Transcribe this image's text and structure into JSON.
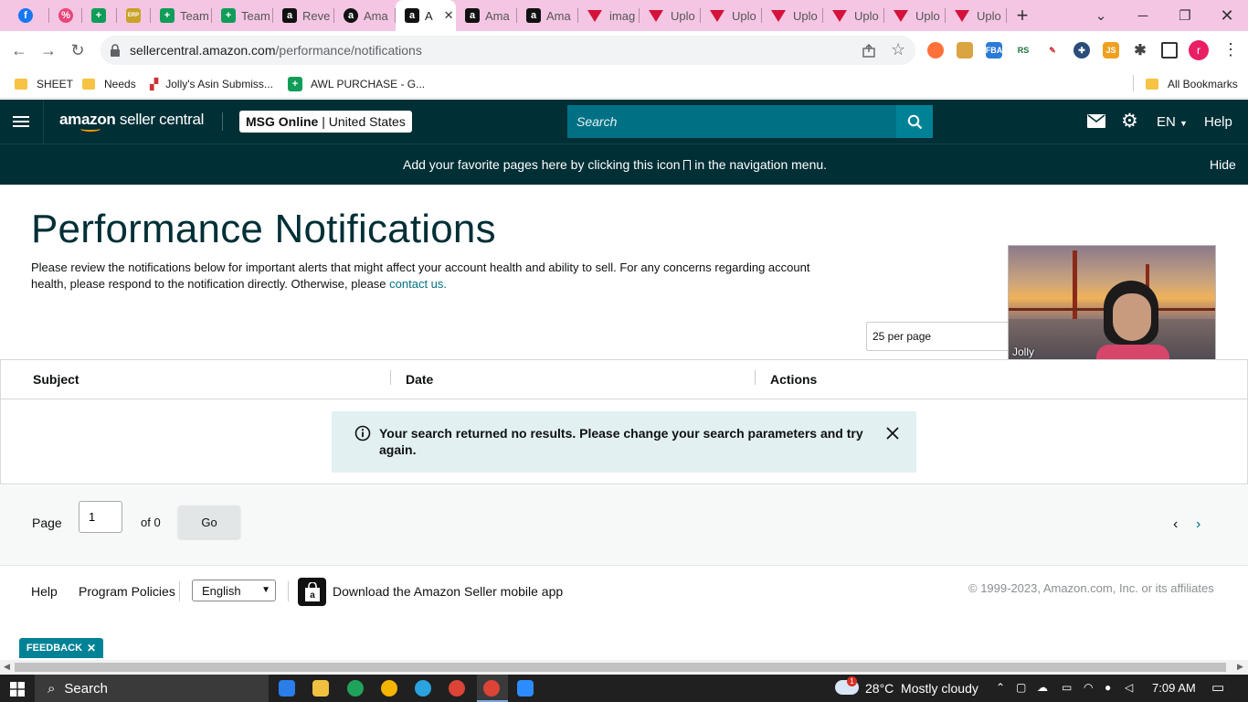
{
  "browser": {
    "tabs": [
      {
        "label": "",
        "icon": "facebook-icon"
      },
      {
        "label": "",
        "icon": "percent-icon"
      },
      {
        "label": "",
        "icon": "sheets-icon"
      },
      {
        "label": "",
        "icon": "erp-icon"
      },
      {
        "label": "Team",
        "icon": "sheets-icon"
      },
      {
        "label": "Team",
        "icon": "sheets-icon"
      },
      {
        "label": "Reve",
        "icon": "amazon-icon"
      },
      {
        "label": "Ama",
        "icon": "amazon-circle-icon"
      },
      {
        "label": "A",
        "icon": "amazon-icon",
        "active": true
      },
      {
        "label": "Ama",
        "icon": "amazon-icon"
      },
      {
        "label": "Ama",
        "icon": "amazon-icon"
      },
      {
        "label": "imag",
        "icon": "triangle-icon"
      },
      {
        "label": "Uplo",
        "icon": "triangle-icon"
      },
      {
        "label": "Uplo",
        "icon": "triangle-icon"
      },
      {
        "label": "Uplo",
        "icon": "triangle-icon"
      },
      {
        "label": "Uplo",
        "icon": "triangle-icon"
      },
      {
        "label": "Uplo",
        "icon": "triangle-icon"
      },
      {
        "label": "Uplo",
        "icon": "triangle-icon"
      }
    ],
    "url_domain": "sellercentral.amazon.com",
    "url_path": "/performance/notifications",
    "profile_initial": "r",
    "bookmarks": {
      "sheet": "SHEET",
      "needs": "Needs",
      "asin": "Jolly's Asin Submiss...",
      "awl": "AWL PURCHASE - G...",
      "all": "All Bookmarks"
    }
  },
  "header": {
    "logo_bold": "amazon",
    "logo_light": " seller central",
    "store_name": "MSG Online",
    "store_sep": " | ",
    "store_region": "United States",
    "search_placeholder": "Search",
    "lang": "EN",
    "help": "Help"
  },
  "banner": {
    "text_before": "Add your favorite pages here by clicking this icon",
    "text_after": "in the navigation menu.",
    "hide": "Hide"
  },
  "page": {
    "title": "Performance Notifications",
    "desc": "Please review the notifications below for important alerts that might affect your account health and ability to sell. For any concerns regarding account health, please respond to the notification directly. Otherwise, please ",
    "contact_link": "contact us.",
    "per_page": "25 per page",
    "video_name": "Jolly"
  },
  "table": {
    "headers": [
      "Subject",
      "Date",
      "Actions"
    ],
    "empty_message": "Your search returned no results. Please change your search parameters and try again."
  },
  "pager": {
    "label": "Page",
    "current": "1",
    "of": "of 0",
    "go": "Go"
  },
  "footer": {
    "help": "Help",
    "policies": "Program Policies",
    "language": "English",
    "app": "Download the Amazon Seller mobile app",
    "copyright": "© 1999-2023, Amazon.com, Inc. or its affiliates",
    "feedback": "FEEDBACK"
  },
  "taskbar": {
    "search": "Search",
    "weather": "28°C  Mostly cloudy",
    "weather_badge": "1",
    "time": "7:09 AM"
  },
  "colors": {
    "header_bg": "#002f36",
    "search_bg": "#007185",
    "link": "#007185",
    "alert_bg": "#e2f0f2",
    "feedback_bg": "#008296",
    "tab_strip": "#f4c6e4"
  }
}
